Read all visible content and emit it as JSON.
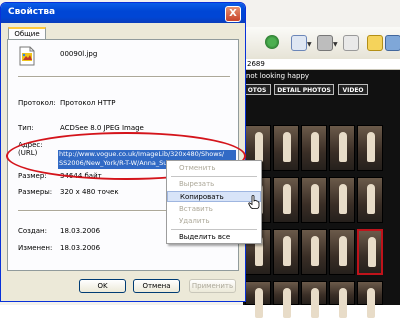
{
  "browser": {
    "address_text": "2689",
    "headline": "not looking happy",
    "tabs": [
      "OTOS",
      "DETAIL PHOTOS",
      "VIDEO"
    ]
  },
  "dialog": {
    "title": "Свойства",
    "close_glyph": "X",
    "tab_label": "Общие",
    "file_name": "00090l.jpg",
    "properties": {
      "protocol_label": "Протокол:",
      "protocol_value": "Протокол HTTP",
      "type_label": "Тип:",
      "type_value": "ACDSee 8.0 JPEG Image",
      "address_label_1": "Адрес:",
      "address_label_2": "(URL)",
      "address_line_1": "http://www.vogue.co.uk/ImageLib/320x480/Shows/",
      "address_line_2": "SS2006/New_York/R-T-W/Anna_Sui/00090l.jpg",
      "size_label": "Размер:",
      "size_value": "34644 байт",
      "dimensions_label": "Размеры:",
      "dimensions_value": "320 x 480 точек",
      "created_label": "Создан:",
      "created_value": "18.03.2006",
      "modified_label": "Изменен:",
      "modified_value": "18.03.2006"
    },
    "buttons": {
      "ok": "OK",
      "cancel": "Отмена",
      "apply": "Применить"
    }
  },
  "context_menu": {
    "items": [
      {
        "label": "Отменить",
        "enabled": false
      },
      {
        "label": "Вырезать",
        "enabled": false
      },
      {
        "label": "Копировать",
        "enabled": true
      },
      {
        "label": "Вставить",
        "enabled": false
      },
      {
        "label": "Удалить",
        "enabled": false
      },
      {
        "label": "Выделить все",
        "enabled": true
      }
    ]
  },
  "colors": {
    "accent_red": "#d4141b",
    "selection_blue": "#316ac5",
    "titlebar_blue": "#0046d5"
  }
}
